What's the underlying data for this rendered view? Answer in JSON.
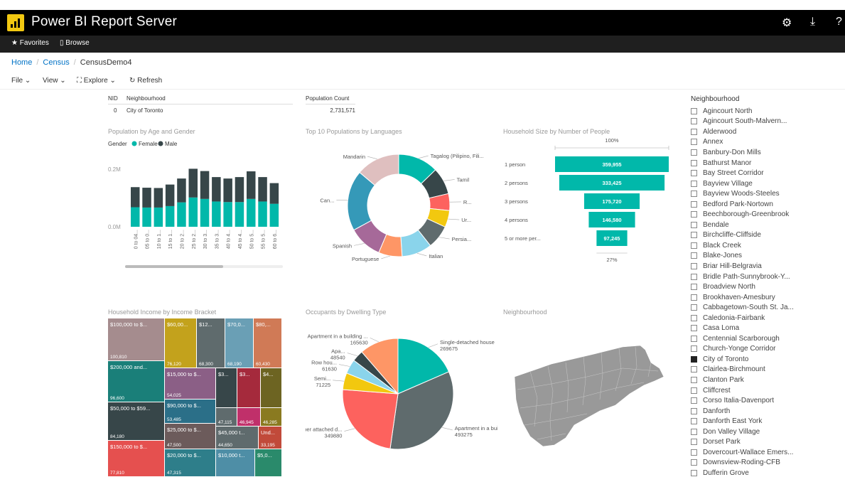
{
  "app": {
    "title": "Power BI Report Server"
  },
  "nav": {
    "favorites": "Favorites",
    "browse": "Browse"
  },
  "breadcrumb": {
    "home": "Home",
    "census": "Census",
    "current": "CensusDemo4"
  },
  "toolbar": {
    "file": "File",
    "view": "View",
    "explore": "Explore",
    "refresh": "Refresh"
  },
  "tables": {
    "nid": {
      "col1": "NID",
      "col2": "Neighbourhood",
      "v1": "0",
      "v2": "City of Toronto"
    },
    "pop": {
      "header": "Population Count",
      "value": "2,731,571"
    }
  },
  "visuals": {
    "age_title": "Population by Age and Gender",
    "lang_title": "Top 10 Populations by Languages",
    "hh_title": "Household Size by Number of People",
    "income_title": "Household Income by Income Bracket",
    "dwelling_title": "Occupants by Dwelling Type",
    "map_title": "Neighbourhood"
  },
  "colors": {
    "teal": "#01b8aa",
    "dark": "#374649",
    "red": "#fd625e",
    "yellow": "#f2c80f",
    "grey": "#5f6b6d",
    "lightblue": "#8ad4eb",
    "orange": "#fe9666",
    "purple": "#a66999",
    "blue": "#3599b8",
    "pink": "#dfbfbf"
  },
  "chart_data": [
    {
      "type": "bar",
      "title": "Population by Age and Gender",
      "legend_title": "Gender",
      "legend": [
        "Female",
        "Male"
      ],
      "y_ticks": [
        "0.2M",
        "0.0M"
      ],
      "ylim": [
        0,
        0.25
      ],
      "categories": [
        "0 to 04...",
        "05 to 0...",
        "10 to 1...",
        "15 to 1...",
        "20 to 2...",
        "25 to 2...",
        "30 to 3...",
        "35 to 3...",
        "40 to 4...",
        "45 to 4...",
        "50 to 5...",
        "55 to 5...",
        "60 to 6..."
      ],
      "series": [
        {
          "name": "Female",
          "values": [
            0.068,
            0.067,
            0.067,
            0.072,
            0.085,
            0.102,
            0.097,
            0.088,
            0.086,
            0.086,
            0.097,
            0.088,
            0.08
          ]
        },
        {
          "name": "Male",
          "values": [
            0.07,
            0.069,
            0.068,
            0.075,
            0.083,
            0.1,
            0.097,
            0.085,
            0.082,
            0.087,
            0.096,
            0.085,
            0.072
          ]
        }
      ]
    },
    {
      "type": "pie",
      "donut": true,
      "title": "Top 10 Populations by Languages",
      "labels": [
        "Tagalog (Pilipino, Fili...",
        "Tamil",
        "R...",
        "Ur...",
        "Persia...",
        "Italian",
        "Portuguese",
        "Spanish",
        "Can...",
        "Mandarin"
      ],
      "values": [
        12,
        8,
        5,
        5,
        7,
        9,
        7,
        10,
        18,
        13
      ]
    },
    {
      "type": "funnel",
      "title": "Household Size by Number of People",
      "top_label": "100%",
      "bottom_label": "27%",
      "categories": [
        "1 person",
        "2 persons",
        "3 persons",
        "4 persons",
        "5 or more per..."
      ],
      "values": [
        359955,
        333425,
        175720,
        146580,
        97245
      ],
      "value_labels": [
        "359,955",
        "333,425",
        "175,720",
        "146,580",
        "97,245"
      ]
    },
    {
      "type": "treemap",
      "title": "Household Income by Income Bracket",
      "items": [
        {
          "label": "$100,000 to $...",
          "value_label": "100,810",
          "value": 100810
        },
        {
          "label": "$200,000 and...",
          "value_label": "96,600",
          "value": 96600
        },
        {
          "label": "$50,000 to $59...",
          "value_label": "84,180",
          "value": 84180
        },
        {
          "label": "$150,000 to $...",
          "value_label": "77,810",
          "value": 77810
        },
        {
          "label": "$60,00...",
          "value_label": "76,120",
          "value": 76120
        },
        {
          "label": "$12...",
          "value_label": "68,300",
          "value": 68300
        },
        {
          "label": "$70,0...",
          "value_label": "68,190",
          "value": 68190
        },
        {
          "label": "$80,...",
          "value_label": "60,430",
          "value": 60430
        },
        {
          "label": "$15,000 to $...",
          "value_label": "54,025",
          "value": 54025
        },
        {
          "label": "$3...",
          "value_label": "",
          "value": 0
        },
        {
          "label": "$3...",
          "value_label": "",
          "value": 0
        },
        {
          "label": "$4...",
          "value_label": "",
          "value": 0
        },
        {
          "label": "$90,000 to $...",
          "value_label": "53,485",
          "value": 53485
        },
        {
          "label": "",
          "value_label": "47,115",
          "value": 47115
        },
        {
          "label": "",
          "value_label": "46,945",
          "value": 46945
        },
        {
          "label": "",
          "value_label": "46,285",
          "value": 46285
        },
        {
          "label": "$25,000 to $...",
          "value_label": "47,500",
          "value": 47500
        },
        {
          "label": "$45,000 t...",
          "value_label": "44,650",
          "value": 44650
        },
        {
          "label": "Und...",
          "value_label": "33,195",
          "value": 33195
        },
        {
          "label": "$20,000 to $...",
          "value_label": "47,315",
          "value": 47315
        },
        {
          "label": "$10,000 t...",
          "value_label": "",
          "value": 0
        },
        {
          "label": "$5,0...",
          "value_label": "",
          "value": 0
        }
      ]
    },
    {
      "type": "pie",
      "title": "Occupants by Dwelling Type",
      "labels": [
        "Single-detached house",
        "Apartment in a build...",
        "Other attached d...",
        "Semi...",
        "Row hou...",
        "Apa...",
        "Apartment in a building ..."
      ],
      "values": [
        269675,
        493275,
        349880,
        71225,
        61630,
        48540,
        165630
      ]
    }
  ],
  "slicer": {
    "title": "Neighbourhood",
    "items": [
      {
        "label": "Agincourt North",
        "checked": false
      },
      {
        "label": "Agincourt South-Malvern...",
        "checked": false
      },
      {
        "label": "Alderwood",
        "checked": false
      },
      {
        "label": "Annex",
        "checked": false
      },
      {
        "label": "Banbury-Don Mills",
        "checked": false
      },
      {
        "label": "Bathurst Manor",
        "checked": false
      },
      {
        "label": "Bay Street Corridor",
        "checked": false
      },
      {
        "label": "Bayview Village",
        "checked": false
      },
      {
        "label": "Bayview Woods-Steeles",
        "checked": false
      },
      {
        "label": "Bedford Park-Nortown",
        "checked": false
      },
      {
        "label": "Beechborough-Greenbrook",
        "checked": false
      },
      {
        "label": "Bendale",
        "checked": false
      },
      {
        "label": "Birchcliffe-Cliffside",
        "checked": false
      },
      {
        "label": "Black Creek",
        "checked": false
      },
      {
        "label": "Blake-Jones",
        "checked": false
      },
      {
        "label": "Briar Hill-Belgravia",
        "checked": false
      },
      {
        "label": "Bridle Path-Sunnybrook-Y...",
        "checked": false
      },
      {
        "label": "Broadview North",
        "checked": false
      },
      {
        "label": "Brookhaven-Amesbury",
        "checked": false
      },
      {
        "label": "Cabbagetown-South St. Ja...",
        "checked": false
      },
      {
        "label": "Caledonia-Fairbank",
        "checked": false
      },
      {
        "label": "Casa Loma",
        "checked": false
      },
      {
        "label": "Centennial Scarborough",
        "checked": false
      },
      {
        "label": "Church-Yonge Corridor",
        "checked": false
      },
      {
        "label": "City of Toronto",
        "checked": true
      },
      {
        "label": "Clairlea-Birchmount",
        "checked": false
      },
      {
        "label": "Clanton Park",
        "checked": false
      },
      {
        "label": "Cliffcrest",
        "checked": false
      },
      {
        "label": "Corso Italia-Davenport",
        "checked": false
      },
      {
        "label": "Danforth",
        "checked": false
      },
      {
        "label": "Danforth East York",
        "checked": false
      },
      {
        "label": "Don Valley Village",
        "checked": false
      },
      {
        "label": "Dorset Park",
        "checked": false
      },
      {
        "label": "Dovercourt-Wallace Emers...",
        "checked": false
      },
      {
        "label": "Downsview-Roding-CFB",
        "checked": false
      },
      {
        "label": "Dufferin Grove",
        "checked": false
      }
    ]
  }
}
